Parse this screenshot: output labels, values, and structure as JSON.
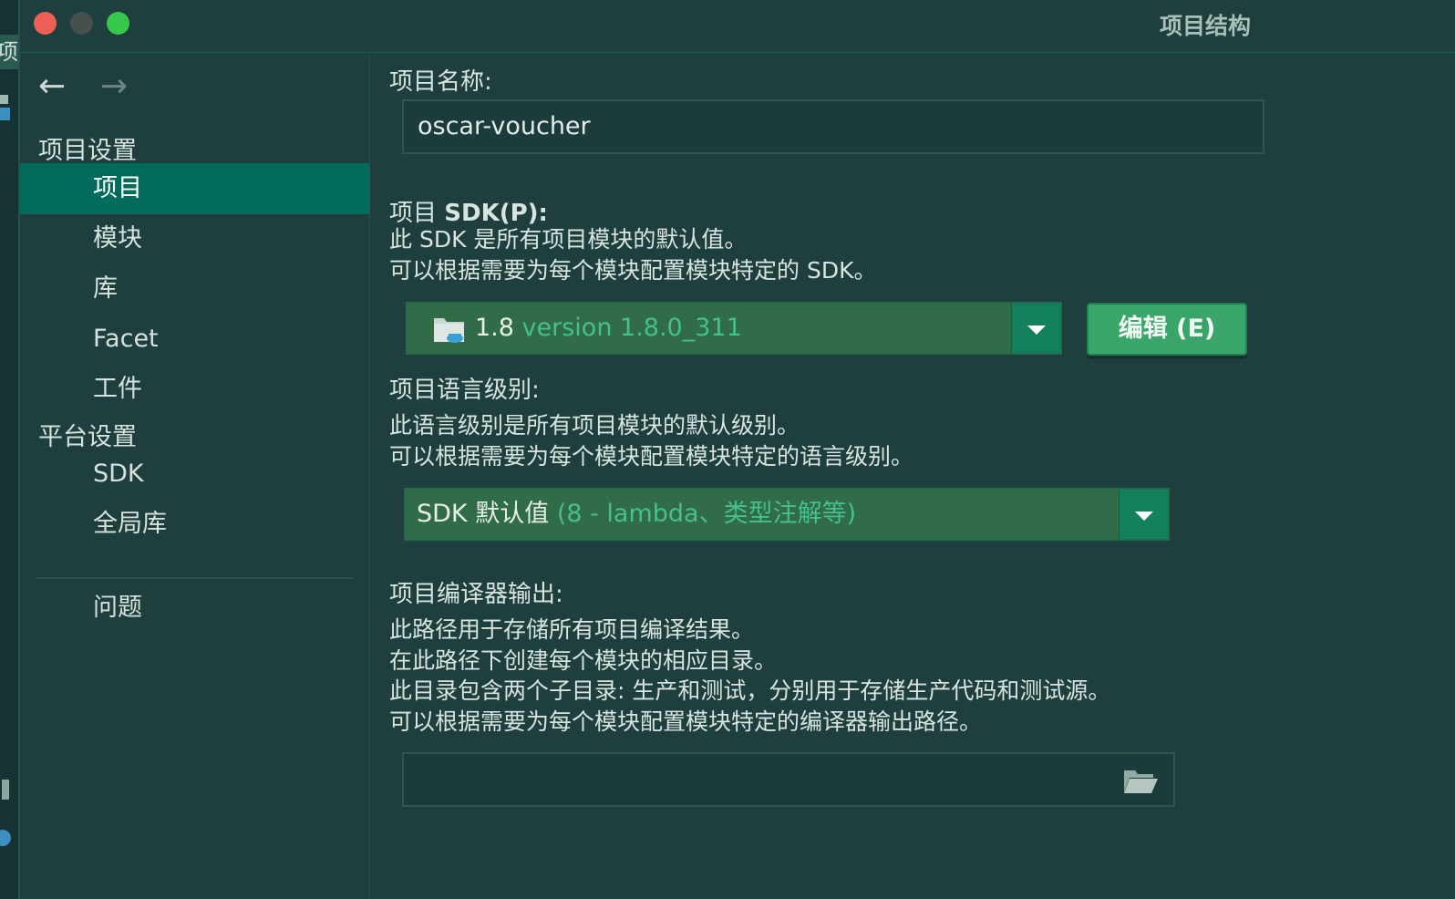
{
  "background_window": {
    "tab_char": "项"
  },
  "window": {
    "title": "项目结构"
  },
  "sidebar": {
    "nav": {
      "back_icon": "arrow-left-icon",
      "forward_icon": "arrow-right-icon"
    },
    "project_settings_header": "项目设置",
    "project_items": [
      {
        "label": "项目",
        "selected": true
      },
      {
        "label": "模块"
      },
      {
        "label": "库"
      },
      {
        "label": "Facet"
      },
      {
        "label": "工件"
      }
    ],
    "platform_settings_header": "平台设置",
    "platform_items": [
      {
        "label": "SDK"
      },
      {
        "label": "全局库"
      }
    ],
    "problems_item": "问题"
  },
  "main": {
    "project_name": {
      "label": "项目名称:",
      "value": "oscar-voucher"
    },
    "project_sdk": {
      "label_prefix": "项目 ",
      "label_bold": "SDK(P):",
      "desc_line1": "此 SDK 是所有项目模块的默认值。",
      "desc_line2": "可以根据需要为每个模块配置模块特定的 SDK。",
      "selected_name": "1.8",
      "selected_detail": "version 1.8.0_311",
      "icon": "jdk-folder-icon",
      "edit_button": "编辑 (E)"
    },
    "language_level": {
      "label": "项目语言级别:",
      "desc_line1": "此语言级别是所有项目模块的默认级别。",
      "desc_line2": "可以根据需要为每个模块配置模块特定的语言级别。",
      "selected_name": "SDK 默认值",
      "selected_detail": "(8 - lambda、类型注解等)"
    },
    "compiler_output": {
      "label": "项目编译器输出:",
      "desc_line1": "此路径用于存储所有项目编译结果。",
      "desc_line2": "在此路径下创建每个模块的相应目录。",
      "desc_line3": "此目录包含两个子目录: 生产和测试，分别用于存储生产代码和测试源。",
      "desc_line4": "可以根据需要为每个模块配置模块特定的编译器输出路径。",
      "value": "",
      "icon": "folder-open-icon"
    }
  },
  "colors": {
    "background": "#1f3f3f",
    "selection": "#036b5b",
    "combo_fill": "#2f6c47",
    "accent_text": "#48bd8f",
    "button": "#3aa569"
  }
}
